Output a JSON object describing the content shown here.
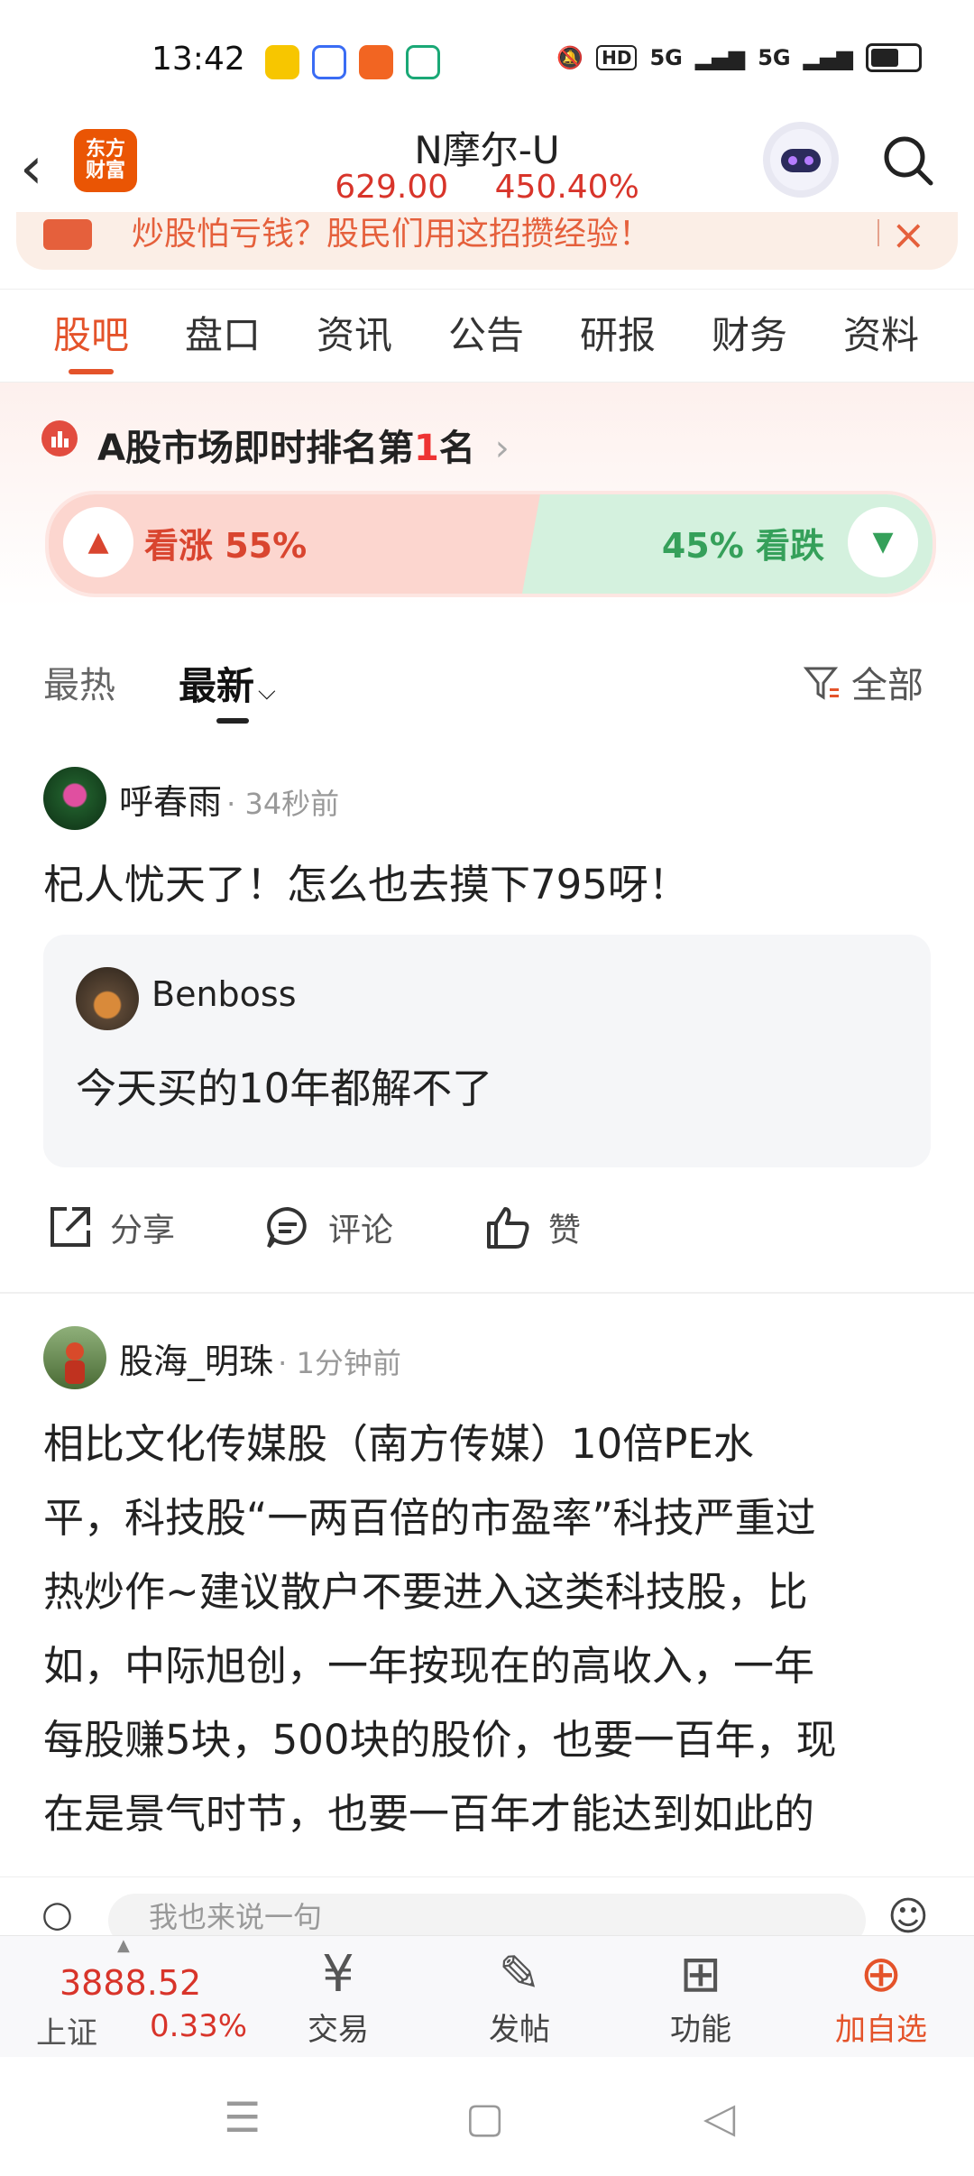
{
  "status_bar": {
    "time": "13:42",
    "network": "5G",
    "hd": "HD"
  },
  "header": {
    "back_label": "‹",
    "logo_line1": "东方",
    "logo_line2": "财富",
    "stock_name": "N摩尔-U",
    "price": "629.00",
    "change_pct": "450.40%"
  },
  "banner": {
    "text": "炒股怕亏钱？股民们用这招攒经验！",
    "close": "×"
  },
  "tabs": [
    "股吧",
    "盘口",
    "资讯",
    "公告",
    "研报",
    "财务",
    "资料"
  ],
  "rank": {
    "prefix": "A股市场即时排名第",
    "number": "1",
    "suffix": "名",
    "arrow": "›"
  },
  "sentiment": {
    "bull_label": "看涨 55%",
    "bear_label": "45% 看跌",
    "bull_pct": 55,
    "bear_pct": 45
  },
  "sort": {
    "hot": "最热",
    "new": "最新",
    "filter": "全部"
  },
  "posts": [
    {
      "username": "呼春雨",
      "time": "· 34秒前",
      "text": "杞人忧天了！怎么也去摸下795呀！",
      "quote": {
        "username": "Benboss",
        "text": "今天买的10年都解不了"
      },
      "actions": {
        "share": "分享",
        "comment": "评论",
        "like": "赞"
      }
    },
    {
      "username": "股海_明珠",
      "time": "· 1分钟前",
      "lines": [
        "相比文化传媒股（南方传媒）10倍PE水",
        "平，科技股“一两百倍的市盈率”科技严重过",
        "热炒作~建议散户不要进入这类科技股，比",
        "如，中际旭创，一年按现在的高收入，一年",
        "每股赚5块，500块的股价，也要一百年，现",
        "在是景气时节，也要一百年才能达到如此的"
      ]
    }
  ],
  "comment_bar": {
    "placeholder": "我也来说一句"
  },
  "bottom_bar": {
    "index_value": "3888.52",
    "index_name": "上证",
    "index_change": "0.33%",
    "trade": "交易",
    "post": "发帖",
    "functions": "功能",
    "watchlist": "加自选"
  }
}
